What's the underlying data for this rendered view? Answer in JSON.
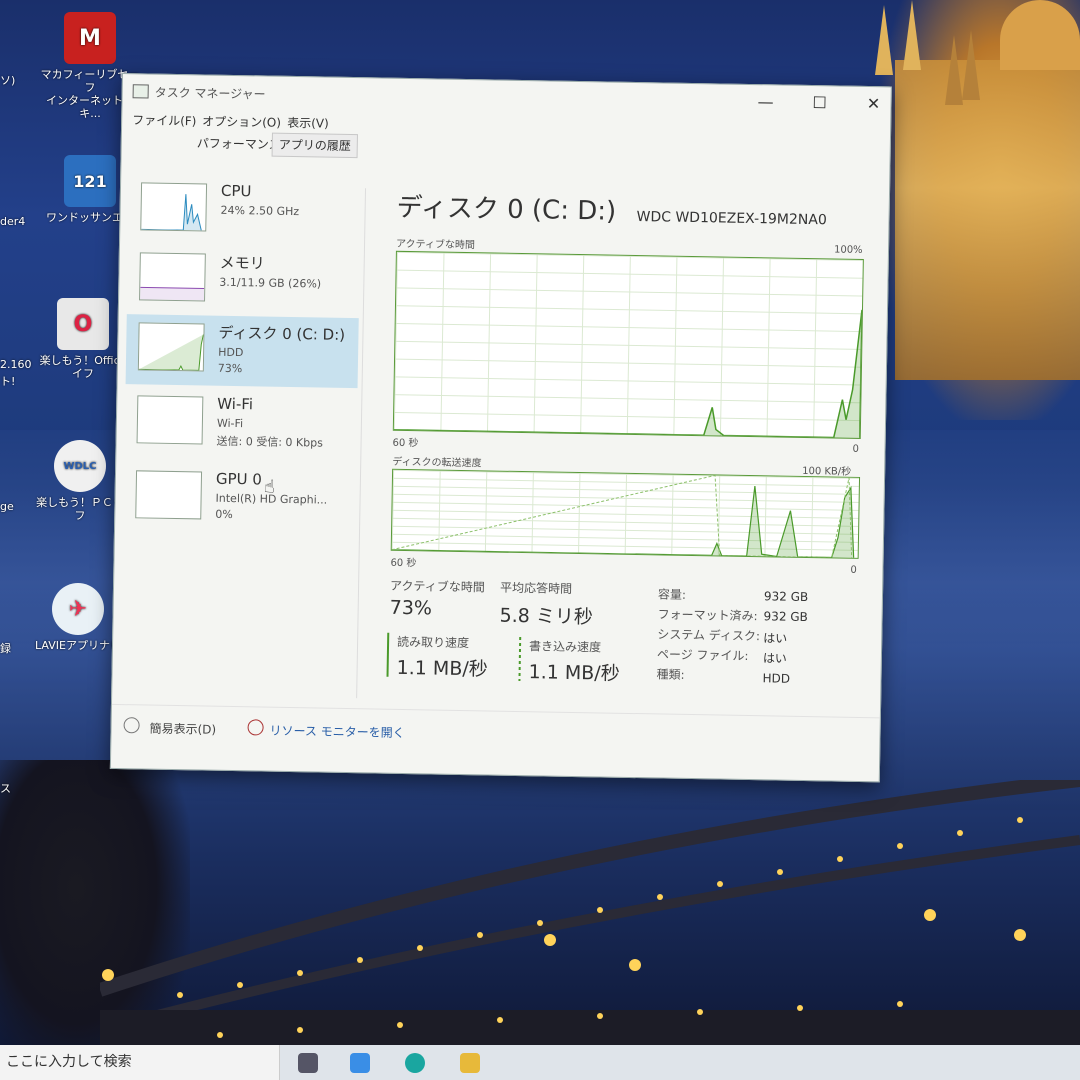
{
  "desktop": {
    "icons": [
      {
        "id": "mcafee",
        "label_line1": "マカフィーリブセーフ",
        "label_line2": "インターネットセキ...",
        "glyph": "M",
        "color": "#c8211f",
        "icon": "mcafee-shield-icon"
      },
      {
        "id": "wantmore",
        "label_line1": "ワンドッサンエア",
        "label_line2": "",
        "glyph": "121",
        "color": "#2c6fbf",
        "icon": "app-icon"
      },
      {
        "id": "office",
        "label_line1": "楽しもう！Office",
        "label_line2": "イフ",
        "glyph": "O",
        "color": "#e8e8e8",
        "icon": "office-guide-icon"
      },
      {
        "id": "pc",
        "label_line1": "楽しもう！ＰＣラ",
        "label_line2": "フ",
        "glyph": "WDLC",
        "color": "#f0f0f0",
        "icon": "pc-guide-icon"
      },
      {
        "id": "lavie",
        "label_line1": "LAVIEアプリナビ",
        "label_line2": "",
        "glyph": "✈",
        "color": "#e9f1f6",
        "icon": "lavie-app-navi-icon"
      }
    ],
    "edge_labels": [
      "ソ)",
      "der4",
      "2.160",
      "ト!",
      "ge",
      "録",
      "ス"
    ]
  },
  "taskbar": {
    "search_placeholder": "ここに入力して検索"
  },
  "window": {
    "title": "タスク マネージャー",
    "controls": {
      "minimize": "—",
      "maximize": "☐",
      "close": "✕"
    },
    "menu": [
      "ファイル(F)",
      "オプション(O)",
      "表示(V)"
    ],
    "tabs": [
      {
        "label": "パフォーマンス",
        "active": true
      },
      {
        "label": "アプリの履歴",
        "active": false
      }
    ],
    "sidebar": [
      {
        "name": "CPU",
        "sub1": "24% 2.50 GHz",
        "sub2": "",
        "selected": false
      },
      {
        "name": "メモリ",
        "sub1": "3.1/11.9 GB (26%)",
        "sub2": "",
        "selected": false
      },
      {
        "name": "ディスク 0 (C: D:)",
        "sub1": "HDD",
        "sub2": "73%",
        "selected": true
      },
      {
        "name": "Wi-Fi",
        "sub1": "Wi-Fi",
        "sub2": "送信: 0 受信: 0 Kbps",
        "selected": false
      },
      {
        "name": "GPU 0",
        "sub1": "Intel(R) HD Graphi...",
        "sub2": "0%",
        "selected": false
      }
    ],
    "detail": {
      "title": "ディスク 0 (C: D:)",
      "model": "WDC WD10EZEX-19M2NA0",
      "graph1": {
        "label": "アクティブな時間",
        "max": "100%",
        "x_left": "60 秒",
        "x_right": "0"
      },
      "graph2": {
        "label": "ディスクの転送速度",
        "max": "100 KB/秒",
        "x_left": "60 秒",
        "x_right": "0"
      },
      "stats": {
        "active_time_label": "アクティブな時間",
        "active_time_value": "73%",
        "avg_resp_label": "平均応答時間",
        "avg_resp_value": "5.8 ミリ秒",
        "read_label": "読み取り速度",
        "read_value": "1.1 MB/秒",
        "write_label": "書き込み速度",
        "write_value": "1.1 MB/秒"
      },
      "props": [
        {
          "k": "容量:",
          "v": "932 GB"
        },
        {
          "k": "フォーマット済み:",
          "v": "932 GB"
        },
        {
          "k": "システム ディスク:",
          "v": "はい"
        },
        {
          "k": "ページ ファイル:",
          "v": "はい"
        },
        {
          "k": "種類:",
          "v": "HDD"
        }
      ]
    },
    "footer": {
      "fewer_details": "簡易表示(D)",
      "resource_monitor": "リソース モニターを開く"
    }
  }
}
